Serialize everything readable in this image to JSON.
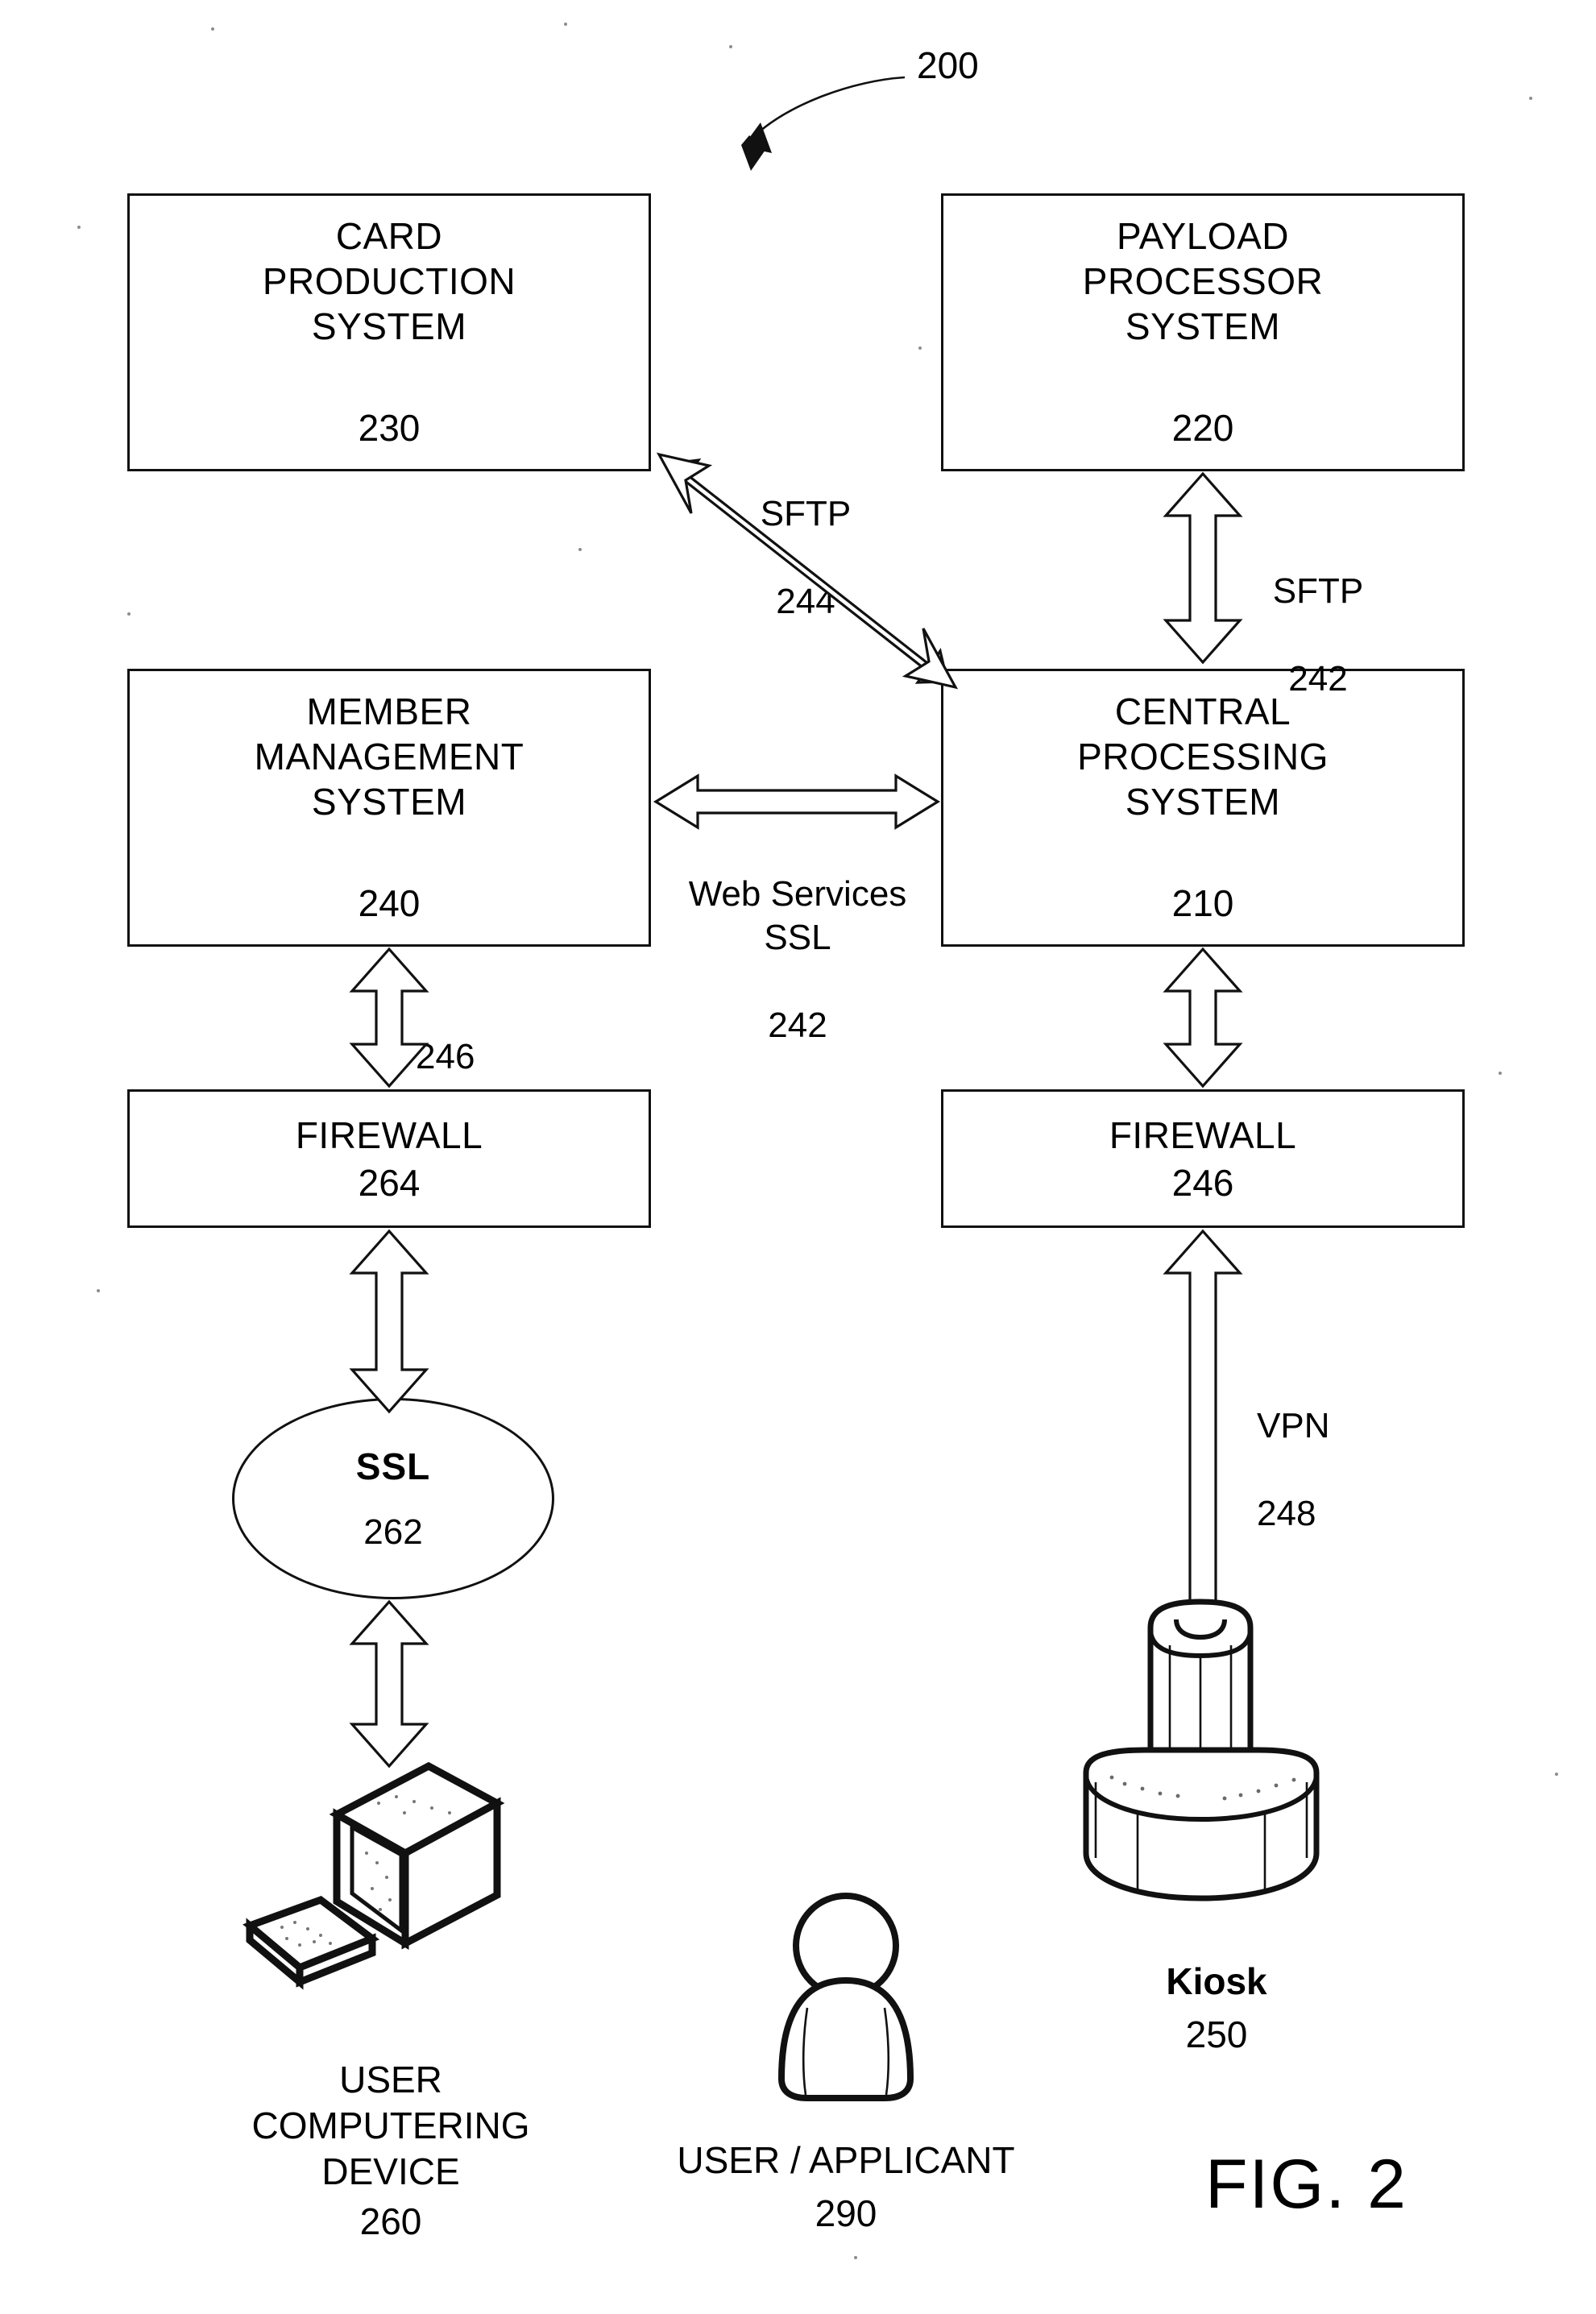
{
  "figure": {
    "caption": "FIG. 2",
    "diagram_ref": "200"
  },
  "nodes": {
    "card_production": {
      "title": "CARD\nPRODUCTION\nSYSTEM",
      "ref": "230"
    },
    "payload_processor": {
      "title": "PAYLOAD\nPROCESSOR\nSYSTEM",
      "ref": "220"
    },
    "member_management": {
      "title": "MEMBER\nMANAGEMENT\nSYSTEM",
      "ref": "240"
    },
    "central_processing": {
      "title": "CENTRAL\nPROCESSING\nSYSTEM",
      "ref": "210"
    },
    "firewall_left": {
      "title": "FIREWALL",
      "ref": "264"
    },
    "firewall_right": {
      "title": "FIREWALL",
      "ref": "246"
    },
    "ssl_cloud": {
      "title": "SSL",
      "ref": "262"
    },
    "kiosk": {
      "title": "Kiosk",
      "ref": "250"
    },
    "user_device": {
      "title": "USER\nCOMPUTERING\nDEVICE",
      "ref": "260"
    },
    "user_applicant": {
      "title": "USER / APPLICANT",
      "ref": "290"
    }
  },
  "connectors": {
    "sftp_244": {
      "label": "SFTP",
      "ref": "244"
    },
    "sftp_242": {
      "label": "SFTP",
      "ref": "242"
    },
    "web_services_ssl_242": {
      "label": "Web Services\nSSL",
      "ref": "242"
    },
    "link_246": {
      "label": "",
      "ref": "246"
    },
    "vpn_248": {
      "label": "VPN",
      "ref": "248"
    }
  },
  "colors": {
    "ink": "#111111",
    "paper": "#ffffff"
  }
}
